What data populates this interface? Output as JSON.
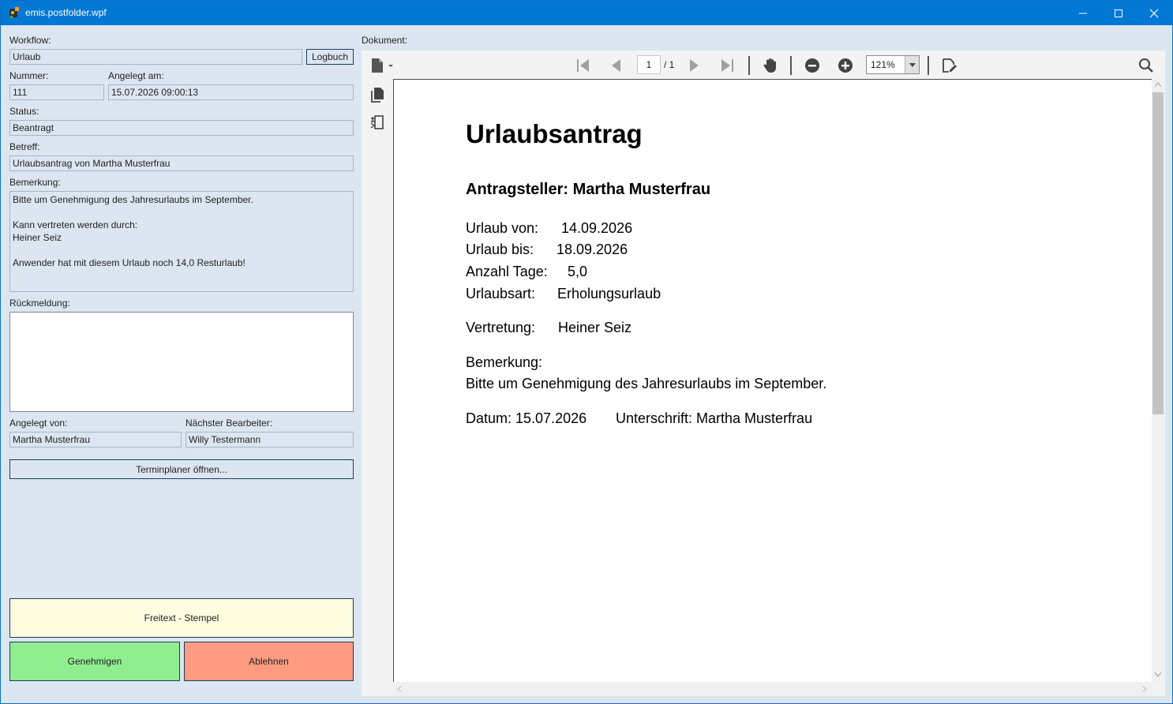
{
  "window": {
    "title": "emis.postfolder.wpf"
  },
  "form": {
    "workflow_label": "Workflow:",
    "workflow_value": "Urlaub",
    "logbuch_button": "Logbuch",
    "nummer_label": "Nummer:",
    "nummer_value": "111",
    "angelegt_am_label": "Angelegt am:",
    "angelegt_am_value": "15.07.2026 09:00:13",
    "status_label": "Status:",
    "status_value": "Beantragt",
    "betreff_label": "Betreff:",
    "betreff_value": "Urlaubsantrag von Martha Musterfrau",
    "bemerkung_label": "Bemerkung:",
    "bemerkung_value": "Bitte um Genehmigung des Jahresurlaubs im September.\n\nKann vertreten werden durch:\nHeiner Seiz\n\nAnwender hat mit diesem Urlaub noch 14,0 Resturlaub!",
    "rueckmeldung_label": "Rückmeldung:",
    "rueckmeldung_value": "",
    "angelegt_von_label": "Angelegt von:",
    "angelegt_von_value": "Martha Musterfrau",
    "naechster_label": "Nächster Bearbeiter:",
    "naechster_value": "Willy Testermann",
    "terminplaner_button": "Terminplaner öffnen...",
    "freitext_button": "Freitext - Stempel",
    "genehmigen_button": "Genehmigen",
    "ablehnen_button": "Ablehnen"
  },
  "viewer": {
    "label": "Dokument:",
    "page_current": "1",
    "page_total": "/ 1",
    "zoom": "121%",
    "icons": [
      "file-menu-icon",
      "first-page-icon",
      "previous-page-icon",
      "next-page-icon",
      "last-page-icon",
      "pan-hand-icon",
      "zoom-out-icon",
      "zoom-in-icon",
      "sign-document-icon",
      "search-icon",
      "thumbnails-icon",
      "bookmarks-icon"
    ]
  },
  "document": {
    "title": "Urlaubsantrag",
    "antragsteller": "Antragsteller: Martha Musterfrau",
    "urlaub_von_label": "Urlaub von:",
    "urlaub_von_value": "14.09.2026",
    "urlaub_bis_label": "Urlaub bis:",
    "urlaub_bis_value": "18.09.2026",
    "anzahl_tage_label": "Anzahl Tage:",
    "anzahl_tage_value": "5,0",
    "urlaubsart_label": "Urlaubsart:",
    "urlaubsart_value": "Erholungsurlaub",
    "vertretung_label": "Vertretung:",
    "vertretung_value": "Heiner Seiz",
    "bemerkung_label": "Bemerkung:",
    "bemerkung_value": "Bitte um Genehmigung des Jahresurlaubs im September.",
    "datum": "Datum: 15.07.2026",
    "unterschrift": "Unterschrift: Martha Musterfrau"
  },
  "colors": {
    "titlebar": "#0078d4",
    "panel_bg": "#dce6f1",
    "freitext_bg": "#fffde0",
    "genehmigen_bg": "#90ee90",
    "ablehnen_bg": "#ff9b80"
  }
}
